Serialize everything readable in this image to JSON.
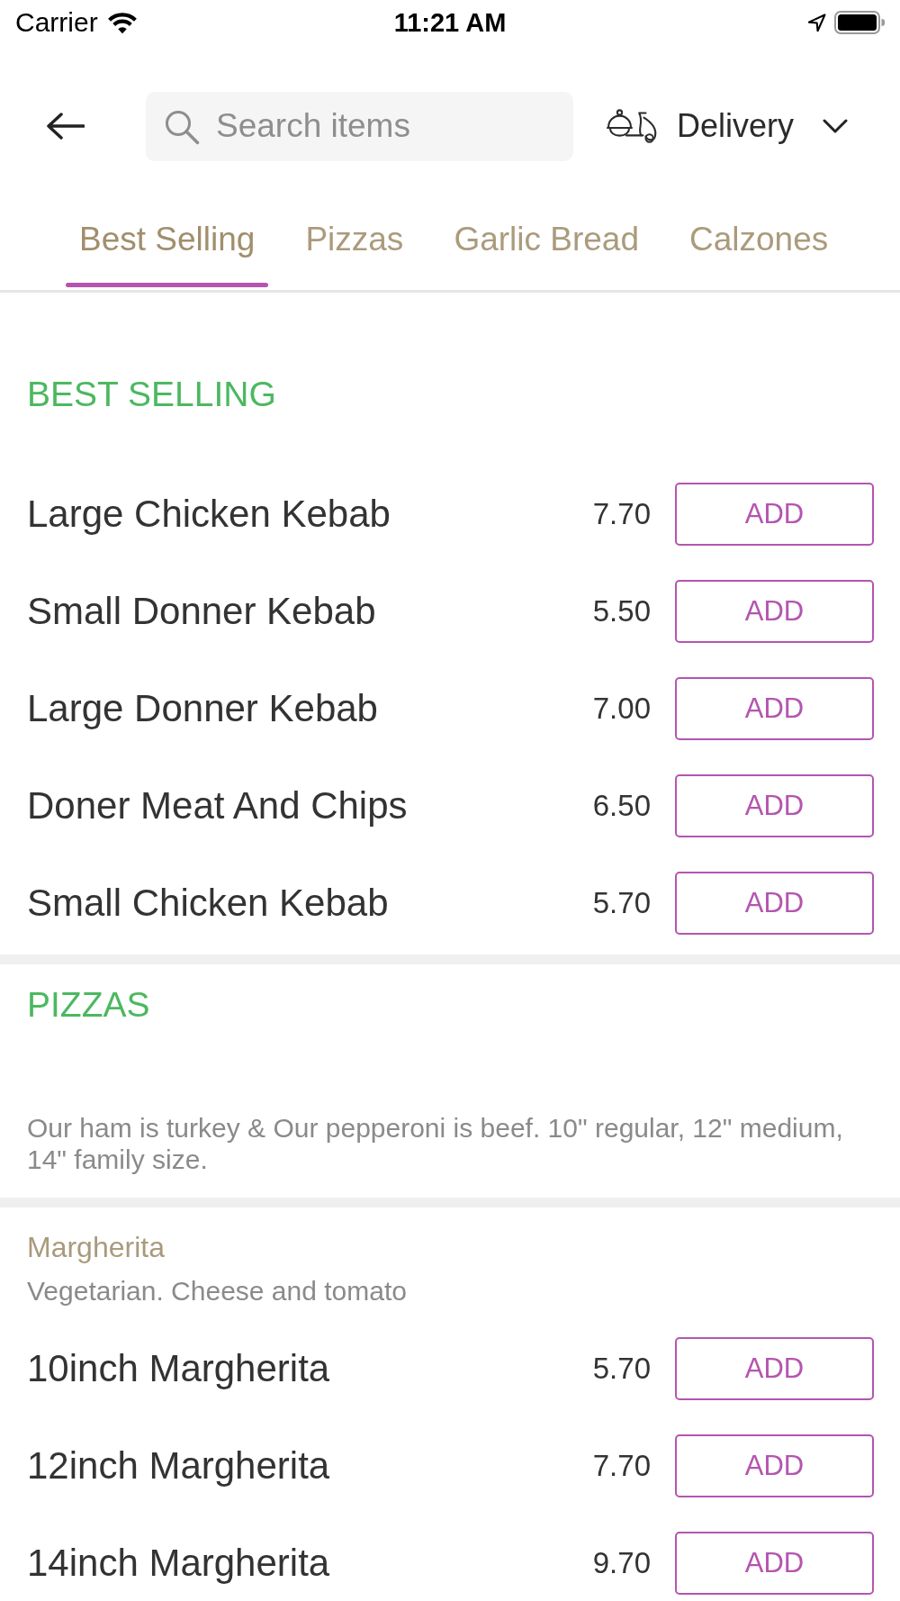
{
  "status_bar": {
    "carrier": "Carrier",
    "time": "11:21 AM"
  },
  "header": {
    "search": {
      "placeholder": "Search items"
    },
    "order_type": {
      "label": "Delivery"
    }
  },
  "tabs": [
    {
      "label": "Best Selling",
      "selected": true
    },
    {
      "label": "Pizzas",
      "selected": false
    },
    {
      "label": "Garlic Bread",
      "selected": false
    },
    {
      "label": "Calzones",
      "selected": false
    }
  ],
  "sections": [
    {
      "title": "BEST SELLING",
      "items": [
        {
          "name": "Large Chicken Kebab",
          "price": "7.70",
          "button": "ADD"
        },
        {
          "name": "Small Donner Kebab",
          "price": "5.50",
          "button": "ADD"
        },
        {
          "name": "Large Donner Kebab",
          "price": "7.00",
          "button": "ADD"
        },
        {
          "name": "Doner Meat And Chips",
          "price": "6.50",
          "button": "ADD"
        },
        {
          "name": "Small Chicken Kebab",
          "price": "5.70",
          "button": "ADD"
        }
      ]
    },
    {
      "title": "PIZZAS",
      "description": "Our ham is turkey & Our pepperoni is beef. 10\" regular, 12\" medium, 14\" family size.",
      "groups": [
        {
          "title": "Margherita",
          "description": "Vegetarian. Cheese and tomato",
          "items": [
            {
              "name": "10inch Margherita",
              "price": "5.70",
              "button": "ADD"
            },
            {
              "name": "12inch Margherita",
              "price": "7.70",
              "button": "ADD"
            },
            {
              "name": "14inch Margherita",
              "price": "9.70",
              "button": "ADD"
            }
          ]
        }
      ]
    }
  ]
}
